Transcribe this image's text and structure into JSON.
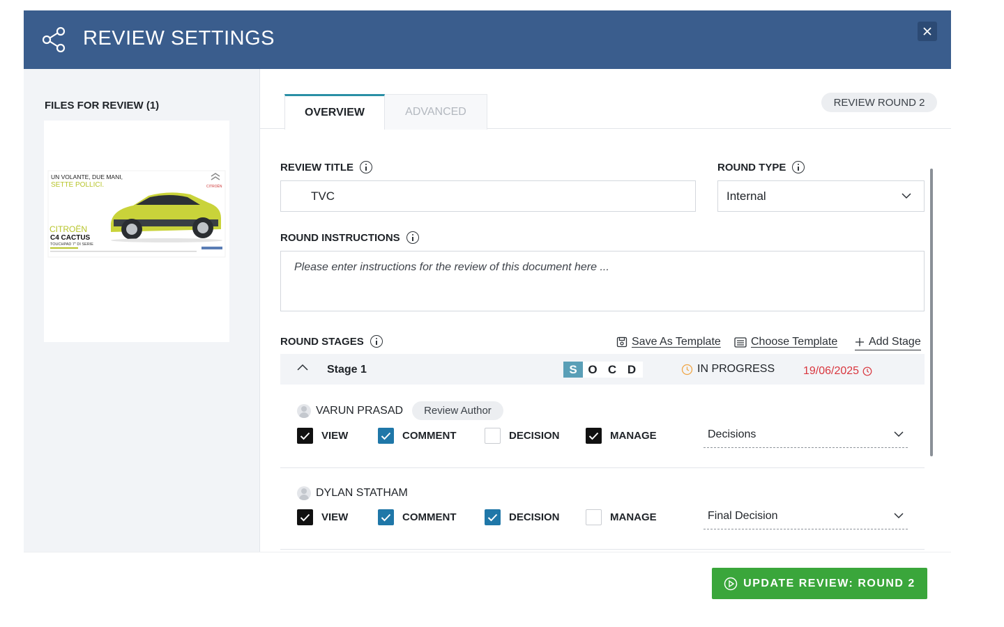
{
  "header": {
    "title": "REVIEW SETTINGS",
    "icon": "share-icon",
    "close_icon": "close-icon"
  },
  "sidebar": {
    "files_label": "FILES FOR REVIEW (1)",
    "thumbnail": {
      "headline_1": "UN VOLANTE, DUE MANI,",
      "headline_2": "SETTE POLLICI.",
      "brand": "CITROËN",
      "model": "C4 CACTUS",
      "tagline": "TOUCHPAD 7\" DI SERIE",
      "logo_text": "CITROËN"
    }
  },
  "tabs": [
    {
      "label": "OVERVIEW",
      "active": true
    },
    {
      "label": "ADVANCED",
      "active": false
    }
  ],
  "round_pill": "REVIEW ROUND 2",
  "form": {
    "review_title_label": "REVIEW TITLE",
    "review_title_value": "TVC",
    "round_type_label": "ROUND TYPE",
    "round_type_value": "Internal",
    "instructions_label": "ROUND INSTRUCTIONS",
    "instructions_placeholder": "Please enter instructions for the review of this document here ..."
  },
  "stages": {
    "label": "ROUND STAGES",
    "save_template": "Save As Template",
    "choose_template": "Choose Template",
    "add_stage": "Add Stage",
    "stage_name": "Stage 1",
    "socd": [
      "S",
      "O",
      "C",
      "D"
    ],
    "socd_active": "S",
    "status": "IN PROGRESS",
    "due_date": "19/06/2025",
    "members": [
      {
        "name": "VARUN PRASAD",
        "role": "Review Author",
        "permissions": {
          "view": "VIEW",
          "comment": "COMMENT",
          "decision": "DECISION",
          "manage": "MANAGE"
        },
        "checked": {
          "view": true,
          "comment": true,
          "decision": false,
          "manage": true
        },
        "decision_type": "Decisions"
      },
      {
        "name": "DYLAN STATHAM",
        "role": "",
        "permissions": {
          "view": "VIEW",
          "comment": "COMMENT",
          "decision": "DECISION",
          "manage": "MANAGE"
        },
        "checked": {
          "view": true,
          "comment": true,
          "decision": true,
          "manage": false
        },
        "decision_type": "Final Decision"
      }
    ]
  },
  "footer": {
    "update_button": "UPDATE REVIEW: ROUND 2"
  },
  "colors": {
    "header": "#3a5d8d",
    "accent_tab": "#2a8fa5",
    "checkbox_blue": "#1f77a8",
    "button_green": "#3aa63b",
    "date_red": "#d9363e"
  }
}
